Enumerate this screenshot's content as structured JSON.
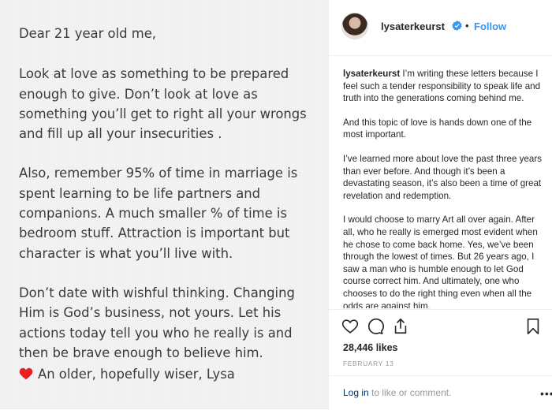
{
  "letter": {
    "greeting": "Dear 21 year old me,",
    "para1": "Look at love as something to be prepared enough to give. Don’t look at love as something you’ll get to right all your wrongs and fill up all your insecurities .",
    "para2": "Also, remember 95% of time in marriage is spent learning to be life partners and companions. A much smaller % of time is bedroom stuff. Attraction is important but character is what you’ll live with.",
    "para3": "Don’t date with wishful thinking. Changing Him is God’s business, not yours. Let his actions today tell you who he really is and then be brave enough to believe him.",
    "signoff": "An older, hopefully wiser, Lysa"
  },
  "post": {
    "username": "lysaterkeurst",
    "dot": "•",
    "follow_label": "Follow",
    "caption_user": "lysaterkeurst",
    "caption_p1": "I’m writing these letters because I feel such a tender responsibility to speak life and truth into the generations coming behind me.",
    "caption_p2": "And this topic of love is hands down one of the most important.",
    "caption_p3": "I’ve learned more about love the past three years than ever before. And though it’s been a devastating season, it’s also been a time of great revelation and redemption.",
    "caption_p4": "I would choose to marry Art all over again. After all, who he really is emerged most evident when he chose to come back home. Yes, we’ve been through the lowest of times. But 26 years ago, I saw a man who is humble enough to let God course correct him. And ultimately, one who chooses to do the right thing even when all the odds are against him.",
    "likes": "28,446 likes",
    "date": "FEBRUARY 13",
    "login_label": "Log in",
    "login_rest": " to like or comment.",
    "more_label": "•••"
  },
  "colors": {
    "link": "#3897f0",
    "heart": "#e8201f",
    "text": "#262626",
    "muted": "#999999"
  },
  "icons": [
    "heart-icon",
    "verified-badge-icon",
    "comment-icon",
    "share-icon",
    "bookmark-icon",
    "red-heart-emoji-icon"
  ]
}
